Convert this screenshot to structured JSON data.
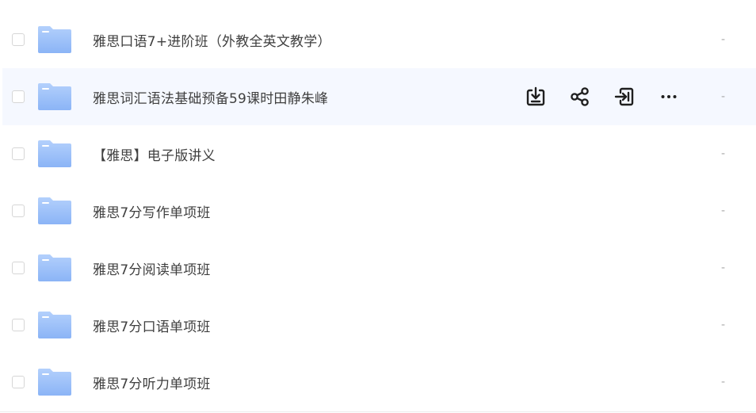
{
  "files": [
    {
      "name": "雅思口语7+进阶班（外教全英文教学）",
      "modified": "-",
      "icon": "folder-icon"
    },
    {
      "name": "雅思词汇语法基础预备59课时田静朱峰",
      "modified": "-",
      "icon": "folder-icon",
      "hovered": true
    },
    {
      "name": "【雅思】电子版讲义",
      "modified": "-",
      "icon": "folder-icon"
    },
    {
      "name": "雅思7分写作单项班",
      "modified": "-",
      "icon": "folder-icon"
    },
    {
      "name": "雅思7分阅读单项班",
      "modified": "-",
      "icon": "folder-icon"
    },
    {
      "name": "雅思7分口语单项班",
      "modified": "-",
      "icon": "folder-icon"
    },
    {
      "name": "雅思7分听力单项班",
      "modified": "-",
      "icon": "folder-icon"
    }
  ],
  "row_actions": [
    {
      "icon": "download-icon"
    },
    {
      "icon": "share-icon"
    },
    {
      "icon": "move-to-icon"
    },
    {
      "icon": "more-icon"
    }
  ],
  "colors": {
    "folder_top": "#a9c9fb",
    "folder_bottom": "#8db6f7",
    "hover_row": "#f5f8ff",
    "action_icon": "#1f1f1f"
  }
}
